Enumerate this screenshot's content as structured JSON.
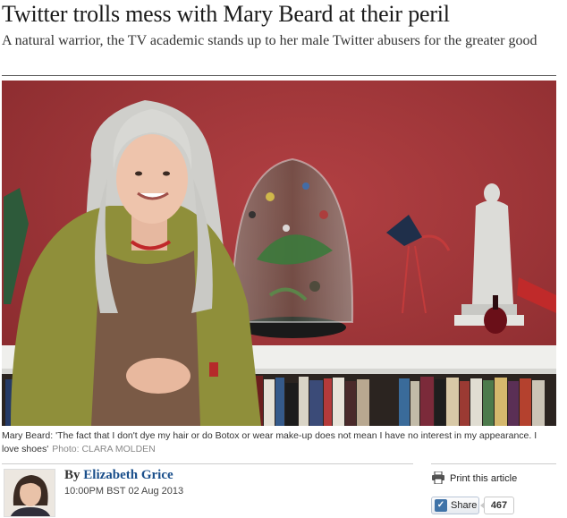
{
  "article": {
    "headline": "Twitter trolls mess with Mary Beard at their peril",
    "standfirst": "A natural warrior, the TV academic stands up to her male Twitter abusers for the greater good",
    "caption": "Mary Beard: 'The fact that I don't dye my hair or do Botox or wear make-up does not mean I have no interest in my appearance. I love shoes'",
    "photo_credit": "Photo: CLARA MOLDEN"
  },
  "byline": {
    "by": "By",
    "author": "Elizabeth Grice",
    "date": "10:00PM BST 02 Aug 2013"
  },
  "tools": {
    "print_label": "Print this article",
    "share_label": "Share",
    "share_count": "467",
    "print_icon": "printer-icon",
    "share_icon": "share-icon"
  },
  "colors": {
    "wall": "#a23a3c",
    "author_link": "#1a4f8b"
  }
}
